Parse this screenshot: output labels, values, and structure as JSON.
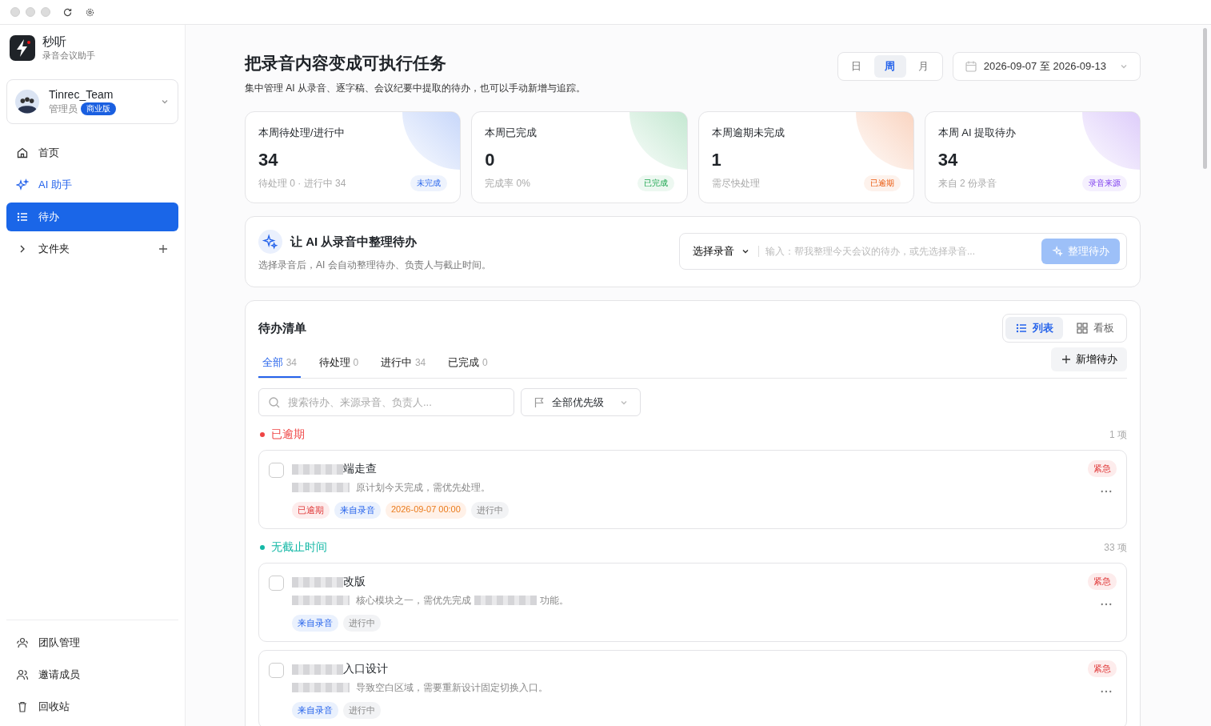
{
  "brand": {
    "name": "秒听",
    "tagline": "录音会议助手"
  },
  "account": {
    "name": "Tinrec_Team",
    "role": "管理员",
    "plan": "商业版"
  },
  "nav": [
    {
      "label": "首页",
      "selected": false
    },
    {
      "label": "AI 助手",
      "selected": false
    },
    {
      "label": "待办",
      "selected": true
    },
    {
      "label": "文件夹",
      "selected": false
    }
  ],
  "nav_bottom": [
    {
      "label": "团队管理"
    },
    {
      "label": "邀请成员"
    },
    {
      "label": "回收站"
    }
  ],
  "header": {
    "title": "把录音内容变成可执行任务",
    "subtitle": "集中管理 AI 从录音、逐字稿、会议纪要中提取的待办，也可以手动新增与追踪。"
  },
  "period": [
    {
      "label": "日",
      "selected": false
    },
    {
      "label": "周",
      "selected": true
    },
    {
      "label": "月",
      "selected": false
    }
  ],
  "date_range": "2026-09-07 至 2026-09-13",
  "stats": [
    {
      "title": "本周待处理/进行中",
      "value": "34",
      "note": "待处理 0 · 进行中 34",
      "badge": "未完成",
      "kind": "blue"
    },
    {
      "title": "本周已完成",
      "value": "0",
      "note": "完成率 0%",
      "badge": "已完成",
      "kind": "green"
    },
    {
      "title": "本周逾期未完成",
      "value": "1",
      "note": "需尽快处理",
      "badge": "已逾期",
      "kind": "orange"
    },
    {
      "title": "本周 AI 提取待办",
      "value": "34",
      "note": "来自 2 份录音",
      "badge": "录音来源",
      "kind": "purple"
    }
  ],
  "ai_panel": {
    "title": "让 AI 从录音中整理待办",
    "subtitle": "选择录音后，AI 会自动整理待办、负责人与截止时间。",
    "select": "选择录音",
    "placeholder": "输入：帮我整理今天会议的待办，或先选择录音...",
    "button": "整理待办",
    "disabled": true
  },
  "list": {
    "title": "待办清单",
    "views": [
      {
        "label": "列表",
        "selected": true
      },
      {
        "label": "看板",
        "selected": false
      }
    ],
    "add_button": "新增待办",
    "tabs": [
      {
        "label": "全部",
        "count": "34",
        "selected": true
      },
      {
        "label": "待处理",
        "count": "0",
        "selected": false
      },
      {
        "label": "进行中",
        "count": "34",
        "selected": false
      },
      {
        "label": "已完成",
        "count": "0",
        "selected": false
      }
    ],
    "search_placeholder": "搜索待办、来源录音、负责人...",
    "priority_filter": "全部优先级",
    "groups": [
      {
        "title": "已逾期",
        "count": "1 项",
        "color": "#ef4444",
        "tasks": [
          {
            "title": "端走查",
            "title_redacted": true,
            "desc": "原计划今天完成，需优先处理。",
            "desc_redacted": true,
            "priority": "紧急",
            "checked": false,
            "tags": [
              {
                "kind": "overdue",
                "text": "已逾期"
              },
              {
                "kind": "source",
                "text": "来自录音"
              },
              {
                "kind": "date",
                "text": "2026-09-07 00:00"
              },
              {
                "kind": "status",
                "text": "进行中"
              }
            ]
          }
        ]
      },
      {
        "title": "无截止时间",
        "count": "33 项",
        "color": "#14b8a6",
        "tasks": [
          {
            "title": "改版",
            "title_redacted": true,
            "desc": "核心模块之一，需优先完成",
            "desc_redacted": true,
            "desc_tail": "功能。",
            "priority": "紧急",
            "checked": false,
            "tags": [
              {
                "kind": "source",
                "text": "来自录音"
              },
              {
                "kind": "status",
                "text": "进行中"
              }
            ]
          },
          {
            "title": "入口设计",
            "title_redacted": true,
            "desc": "导致空白区域，需要重新设计固定切换入口。",
            "desc_redacted": true,
            "priority": "紧急",
            "checked": false,
            "tags": [
              {
                "kind": "source",
                "text": "来自录音"
              },
              {
                "kind": "status",
                "text": "进行中"
              }
            ]
          }
        ]
      }
    ]
  }
}
